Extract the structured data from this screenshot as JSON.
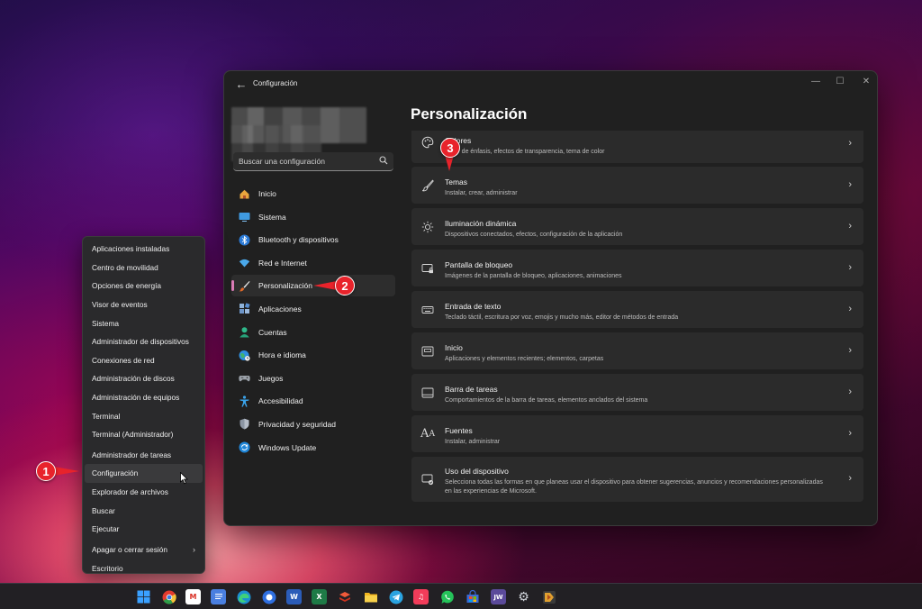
{
  "window": {
    "title": "Configuración",
    "search_placeholder": "Buscar una configuración",
    "page_title": "Personalización"
  },
  "nav": [
    {
      "label": "Inicio",
      "icon": "home-icon"
    },
    {
      "label": "Sistema",
      "icon": "monitor-icon"
    },
    {
      "label": "Bluetooth y dispositivos",
      "icon": "bluetooth-icon"
    },
    {
      "label": "Red e Internet",
      "icon": "wifi-icon"
    },
    {
      "label": "Personalización",
      "icon": "brush-icon",
      "active": true
    },
    {
      "label": "Aplicaciones",
      "icon": "apps-icon"
    },
    {
      "label": "Cuentas",
      "icon": "account-icon"
    },
    {
      "label": "Hora e idioma",
      "icon": "globe-clock-icon"
    },
    {
      "label": "Juegos",
      "icon": "gamepad-icon"
    },
    {
      "label": "Accesibilidad",
      "icon": "accessibility-icon"
    },
    {
      "label": "Privacidad y seguridad",
      "icon": "shield-icon"
    },
    {
      "label": "Windows Update",
      "icon": "update-icon"
    }
  ],
  "cards": [
    {
      "title": "Colores",
      "subtitle": "Color de énfasis, efectos de transparencia, tema de color",
      "icon": "palette-icon"
    },
    {
      "title": "Temas",
      "subtitle": "Instalar, crear, administrar",
      "icon": "brush-icon"
    },
    {
      "title": "Iluminación dinámica",
      "subtitle": "Dispositivos conectados, efectos, configuración de la aplicación",
      "icon": "sun-icon"
    },
    {
      "title": "Pantalla de bloqueo",
      "subtitle": "Imágenes de la pantalla de bloqueo, aplicaciones, animaciones",
      "icon": "lock-screen-icon"
    },
    {
      "title": "Entrada de texto",
      "subtitle": "Teclado táctil, escritura por voz, emojis y mucho más, editor de métodos de entrada",
      "icon": "keyboard-icon"
    },
    {
      "title": "Inicio",
      "subtitle": "Aplicaciones y elementos recientes; elementos, carpetas",
      "icon": "start-icon"
    },
    {
      "title": "Barra de tareas",
      "subtitle": "Comportamientos de la barra de tareas, elementos anclados del sistema",
      "icon": "taskbar-icon"
    },
    {
      "title": "Fuentes",
      "subtitle": "Instalar, administrar",
      "icon": "fonts-icon"
    },
    {
      "title": "Uso del dispositivo",
      "subtitle": "Selecciona todas las formas en que planeas usar el dispositivo para obtener sugerencias, anuncios y recomendaciones personalizadas en las experiencias de Microsoft.",
      "icon": "device-usage-icon"
    }
  ],
  "context_menu": [
    {
      "label": "Aplicaciones instaladas"
    },
    {
      "label": "Centro de movilidad"
    },
    {
      "label": "Opciones de energía"
    },
    {
      "label": "Visor de eventos"
    },
    {
      "label": "Sistema"
    },
    {
      "label": "Administrador de dispositivos"
    },
    {
      "label": "Conexiones de red"
    },
    {
      "label": "Administración de discos"
    },
    {
      "label": "Administración de equipos"
    },
    {
      "label": "Terminal"
    },
    {
      "label": "Terminal (Administrador)"
    },
    {
      "label": "Administrador de tareas"
    },
    {
      "label": "Configuración",
      "highlight": true
    },
    {
      "label": "Explorador de archivos"
    },
    {
      "label": "Buscar"
    },
    {
      "label": "Ejecutar"
    },
    {
      "label": "Apagar o cerrar sesión",
      "submenu": true
    },
    {
      "label": "Escritorio"
    }
  ],
  "callouts": [
    "1",
    "2",
    "3"
  ],
  "taskbar": [
    {
      "name": "windows-start-icon",
      "color": "#3aa0ff",
      "glyph": ""
    },
    {
      "name": "chrome-icon",
      "color": "#e8b400",
      "glyph": ""
    },
    {
      "name": "gmail-icon",
      "color": "#ffffff",
      "glyph": "M"
    },
    {
      "name": "docs-icon",
      "color": "#4a7fe0",
      "glyph": ""
    },
    {
      "name": "edge-icon",
      "color": "#1fa0c8",
      "glyph": ""
    },
    {
      "name": "browser-icon",
      "color": "#2f6fe0",
      "glyph": ""
    },
    {
      "name": "word-icon",
      "color": "#2b5cb8",
      "glyph": "W"
    },
    {
      "name": "excel-icon",
      "color": "#1e7a46",
      "glyph": "X"
    },
    {
      "name": "stack-icon",
      "color": "#d23a2a",
      "glyph": ""
    },
    {
      "name": "file-explorer-icon",
      "color": "#f2c230",
      "glyph": ""
    },
    {
      "name": "telegram-icon",
      "color": "#2aa3e0",
      "glyph": ""
    },
    {
      "name": "music-icon",
      "color": "#f23c5a",
      "glyph": "♫"
    },
    {
      "name": "whatsapp-icon",
      "color": "#25c35a",
      "glyph": ""
    },
    {
      "name": "store-icon",
      "color": "#3a6ad6",
      "glyph": ""
    },
    {
      "name": "jw-icon",
      "color": "#5b4a9a",
      "glyph": "JW"
    },
    {
      "name": "settings-gear-icon",
      "color": "#8a8a8a",
      "glyph": "⚙"
    },
    {
      "name": "app-icon",
      "color": "#c06a20",
      "glyph": ""
    }
  ]
}
